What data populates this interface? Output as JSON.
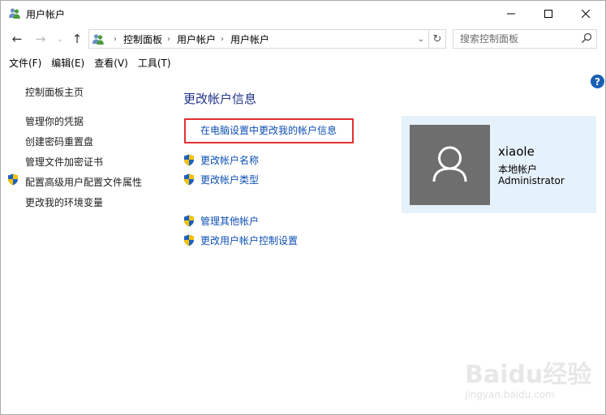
{
  "window": {
    "title": "用户帐户"
  },
  "address": {
    "crumbs": [
      "控制面板",
      "用户帐户",
      "用户帐户"
    ]
  },
  "search": {
    "placeholder": "搜索控制面板"
  },
  "menu": [
    "文件(F)",
    "编辑(E)",
    "查看(V)",
    "工具(T)"
  ],
  "sidebar": {
    "home": "控制面板主页",
    "items": [
      "管理你的凭据",
      "创建密码重置盘",
      "管理文件加密证书",
      "配置高级用户配置文件属性",
      "更改我的环境变量"
    ]
  },
  "main": {
    "heading": "更改帐户信息",
    "pc_settings_link": "在电脑设置中更改我的帐户信息",
    "tasks": [
      "更改帐户名称",
      "更改帐户类型"
    ],
    "other_tasks": [
      "管理其他帐户",
      "更改用户帐户控制设置"
    ]
  },
  "account": {
    "name": "xiaole",
    "type": "本地帐户",
    "role": "Administrator"
  },
  "watermark": {
    "logo": "Baidu经验",
    "url": "jingyan.baidu.com"
  },
  "colors": {
    "link": "#0d4fb3",
    "heading": "#1e3287",
    "highlight": "#e23030",
    "card": "#e5f1fb",
    "avatar": "#6e6e6e"
  }
}
